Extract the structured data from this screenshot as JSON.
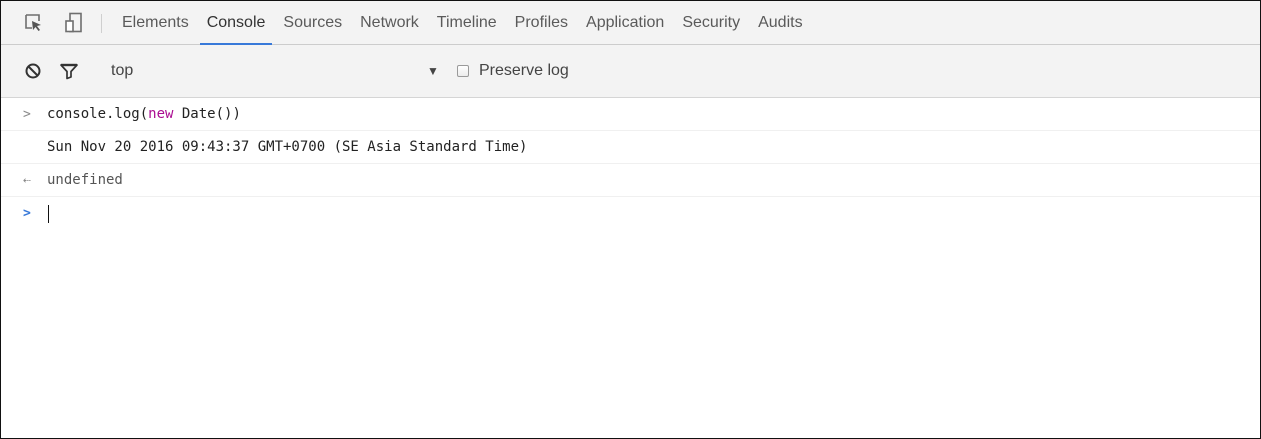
{
  "tabbar": {
    "icons": {
      "inspect": "inspect-element-icon",
      "device": "device-mode-icon"
    },
    "tabs": [
      {
        "label": "Elements",
        "active": false
      },
      {
        "label": "Console",
        "active": true
      },
      {
        "label": "Sources",
        "active": false
      },
      {
        "label": "Network",
        "active": false
      },
      {
        "label": "Timeline",
        "active": false
      },
      {
        "label": "Profiles",
        "active": false
      },
      {
        "label": "Application",
        "active": false
      },
      {
        "label": "Security",
        "active": false
      },
      {
        "label": "Audits",
        "active": false
      }
    ],
    "accent_color": "#3879d9"
  },
  "toolbar": {
    "clear_icon": "clear-console-icon",
    "filter_icon": "filter-icon",
    "context": "top",
    "dropdown_icon": "dropdown-arrow-icon",
    "preserve_log_label": "Preserve log",
    "preserve_log_checked": false
  },
  "console": {
    "entries": [
      {
        "type": "input",
        "gutter": ">",
        "code_before": "console.log(",
        "code_keyword": "new",
        "code_after": " Date())"
      },
      {
        "type": "log",
        "text": "Sun Nov 20 2016 09:43:37 GMT+0700 (SE Asia Standard Time)"
      },
      {
        "type": "result",
        "gutter": "⇠",
        "text": "undefined"
      }
    ],
    "prompt": {
      "gutter": ">",
      "value": ""
    },
    "keyword_color": "#aa0d91"
  }
}
